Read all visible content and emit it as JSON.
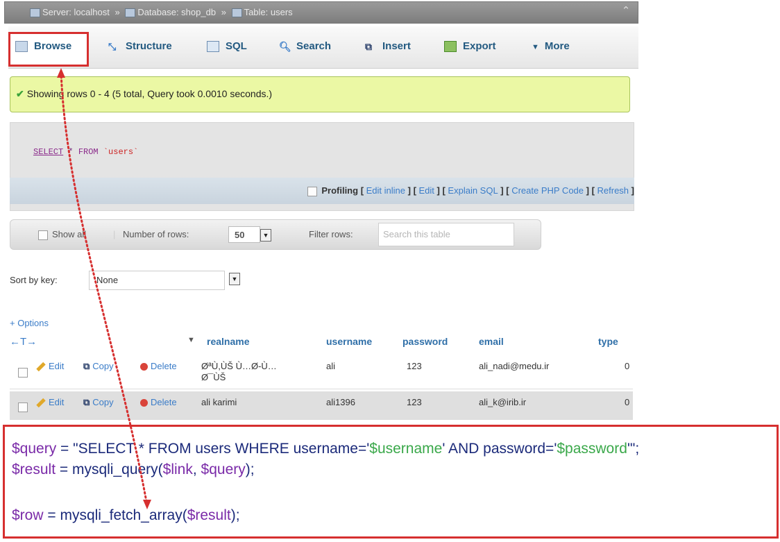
{
  "breadcrumb": {
    "server": "Server: localhost",
    "database": "Database: shop_db",
    "table": "Table: users",
    "separator": "»"
  },
  "tabs": [
    {
      "label": "Browse",
      "icon": "browse-icon"
    },
    {
      "label": "Structure",
      "icon": "structure-icon"
    },
    {
      "label": "SQL",
      "icon": "sql-icon"
    },
    {
      "label": "Search",
      "icon": "search-icon"
    },
    {
      "label": "Insert",
      "icon": "insert-icon"
    },
    {
      "label": "Export",
      "icon": "export-icon"
    },
    {
      "label": "More",
      "icon": "chevron-down-icon"
    }
  ],
  "success_message": "Showing rows 0 - 4 (5 total, Query took 0.0010 seconds.)",
  "sql": {
    "kw_select": "SELECT",
    "star": "*",
    "kw_from": "FROM",
    "table": "`users`"
  },
  "sql_links": {
    "profiling": "Profiling",
    "edit_inline": "Edit inline",
    "edit": "Edit",
    "explain": "Explain SQL",
    "create_php": "Create PHP Code",
    "refresh": "Refresh"
  },
  "nav": {
    "show_all": "Show all",
    "number_of_rows_label": "Number of rows:",
    "number_of_rows_value": "50",
    "filter_label": "Filter rows:",
    "filter_placeholder": "Search this table"
  },
  "sort": {
    "label": "Sort by key:",
    "value": "None"
  },
  "table": {
    "options_link": "+ Options",
    "arrows": "←T→",
    "columns": [
      "realname",
      "username",
      "password",
      "email",
      "type"
    ],
    "rows": [
      {
        "edit": "Edit",
        "copy": "Copy",
        "delete": "Delete",
        "realname": "ØªÙ,ÙŠ Ù…Ø-Ù…Ø¯ÙŠ",
        "username": "ali",
        "password": "123",
        "email": "ali_nadi@medu.ir",
        "type": "0"
      },
      {
        "edit": "Edit",
        "copy": "Copy",
        "delete": "Delete",
        "realname": "ali karimi",
        "username": "ali1396",
        "password": "123",
        "email": "ali_k@irib.ir",
        "type": "0"
      }
    ]
  },
  "code": {
    "line1": [
      "$query",
      " = \"SELECT * FROM users WHERE username='",
      "$username",
      "' AND password='",
      "$password",
      "'\";"
    ],
    "line2": [
      "$result",
      " = mysqli_query(",
      "$link",
      ", ",
      "$query",
      ");"
    ],
    "line3": [
      "$row",
      " = mysqli_fetch_array(",
      "$result",
      ");"
    ]
  },
  "colors": {
    "highlight_red": "#d62f2f",
    "link_blue": "#3a7cc8",
    "success_bg": "#ebf8a4",
    "code_var": "#7a2aa8",
    "code_string": "#3aa84a"
  }
}
